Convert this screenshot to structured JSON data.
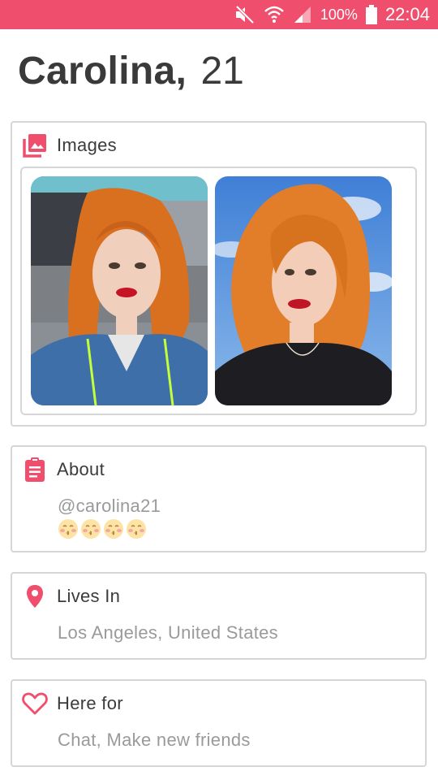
{
  "status_bar": {
    "battery_text": "100%",
    "time": "22:04",
    "color": "#ef4e6d"
  },
  "profile": {
    "name": "Carolina,",
    "age": "21"
  },
  "images": {
    "label": "Images",
    "photos": [
      {
        "description_icon": "photo-1"
      },
      {
        "description_icon": "photo-2"
      }
    ]
  },
  "about": {
    "label": "About",
    "handle": "@carolina21",
    "emojis": [
      "😚",
      "😚",
      "😚",
      "😚"
    ]
  },
  "lives_in": {
    "label": "Lives In",
    "value": "Los Angeles, United States"
  },
  "here_for": {
    "label": "Here for",
    "value": "Chat, Make new friends"
  },
  "colors": {
    "accent": "#ef4e6d",
    "border": "#d6d6d6",
    "text": "#3b3b3b",
    "muted": "#9a9a9a"
  },
  "icons": [
    "mute-icon",
    "wifi-icon",
    "signal-icon",
    "battery-icon",
    "image-icon",
    "clipboard-icon",
    "location-pin-icon",
    "heart-icon"
  ]
}
